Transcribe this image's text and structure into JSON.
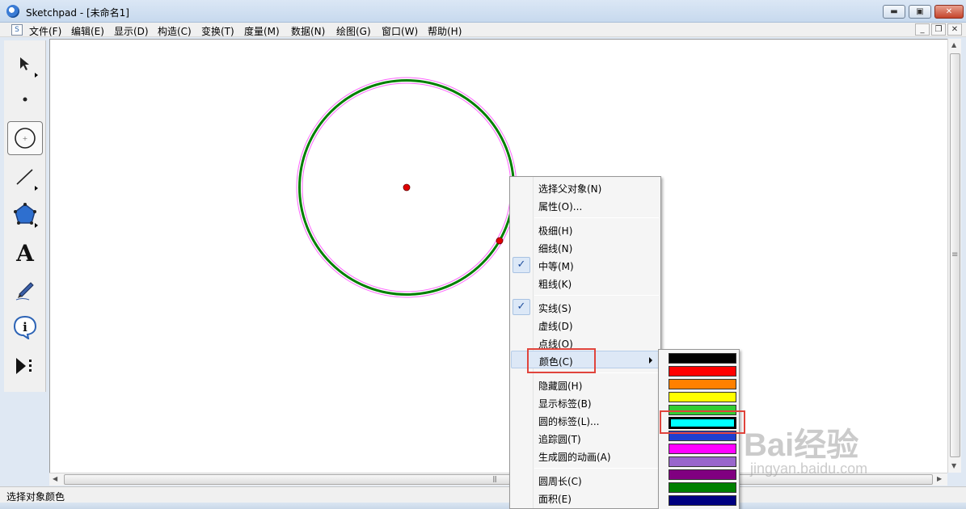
{
  "window": {
    "title": "Sketchpad  - [未命名1]",
    "minimize_glyph": "▬",
    "maximize_glyph": "▣",
    "close_glyph": "✕"
  },
  "menubar": {
    "items": [
      "文件(F)",
      "编辑(E)",
      "显示(D)",
      "构造(C)",
      "变换(T)",
      "度量(M)",
      "数据(N)",
      "绘图(G)",
      "窗口(W)",
      "帮助(H)"
    ],
    "mdi_minimize": "_",
    "mdi_restore": "❐",
    "mdi_close": "✕"
  },
  "toolbox": {
    "tools": [
      {
        "name": "arrow-select-tool",
        "icon": "arrow-icon"
      },
      {
        "name": "point-tool",
        "icon": "point-icon"
      },
      {
        "name": "compass-tool",
        "icon": "circle-icon",
        "active": true
      },
      {
        "name": "straightedge-tool",
        "icon": "line-icon"
      },
      {
        "name": "polygon-tool",
        "icon": "polygon-icon"
      },
      {
        "name": "text-tool",
        "icon": "text-icon",
        "glyph": "A"
      },
      {
        "name": "marker-tool",
        "icon": "marker-icon"
      },
      {
        "name": "information-tool",
        "icon": "info-icon",
        "glyph": "i"
      },
      {
        "name": "custom-tool",
        "icon": "custom-tools-icon"
      }
    ]
  },
  "context_menu": {
    "groups": [
      [
        {
          "label": "选择父对象(N)"
        },
        {
          "label": "属性(O)..."
        }
      ],
      [
        {
          "label": "极细(H)"
        },
        {
          "label": "细线(N)"
        },
        {
          "label": "中等(M)",
          "checked": true
        },
        {
          "label": "粗线(K)"
        }
      ],
      [
        {
          "label": "实线(S)",
          "checked": true
        },
        {
          "label": "虚线(D)"
        },
        {
          "label": "点线(O)"
        },
        {
          "label": "颜色(C)",
          "submenu": true,
          "hover": true
        }
      ],
      [
        {
          "label": "隐藏圆(H)"
        },
        {
          "label": "显示标签(B)"
        },
        {
          "label": "圆的标签(L)..."
        },
        {
          "label": "追踪圆(T)"
        },
        {
          "label": "生成圆的动画(A)"
        }
      ],
      [
        {
          "label": "圆周长(C)"
        },
        {
          "label": "面积(E)"
        }
      ]
    ],
    "check_glyph": "✓"
  },
  "color_palette": {
    "swatches": [
      "#000000",
      "#ff0000",
      "#ff8000",
      "#ffff00",
      "#33cc33",
      "#00ffff",
      "#1f3fd0",
      "#ff00ff",
      "#9966cc",
      "#800080",
      "#008000",
      "#000080"
    ],
    "selected_index": 5
  },
  "status_bar": {
    "text": "选择对象颜色"
  },
  "scroll": {
    "up": "▲",
    "down": "▼",
    "left": "◀",
    "right": "▶",
    "grip": "|||",
    "vgrip": "≡"
  },
  "watermark": {
    "brand": "Bai经验",
    "url": "jingyan.baidu.com"
  },
  "colors": {
    "circle_outer": "#ff66ff",
    "circle_inner": "#008000",
    "point": "#e00000",
    "highlight": "#e0443c"
  }
}
